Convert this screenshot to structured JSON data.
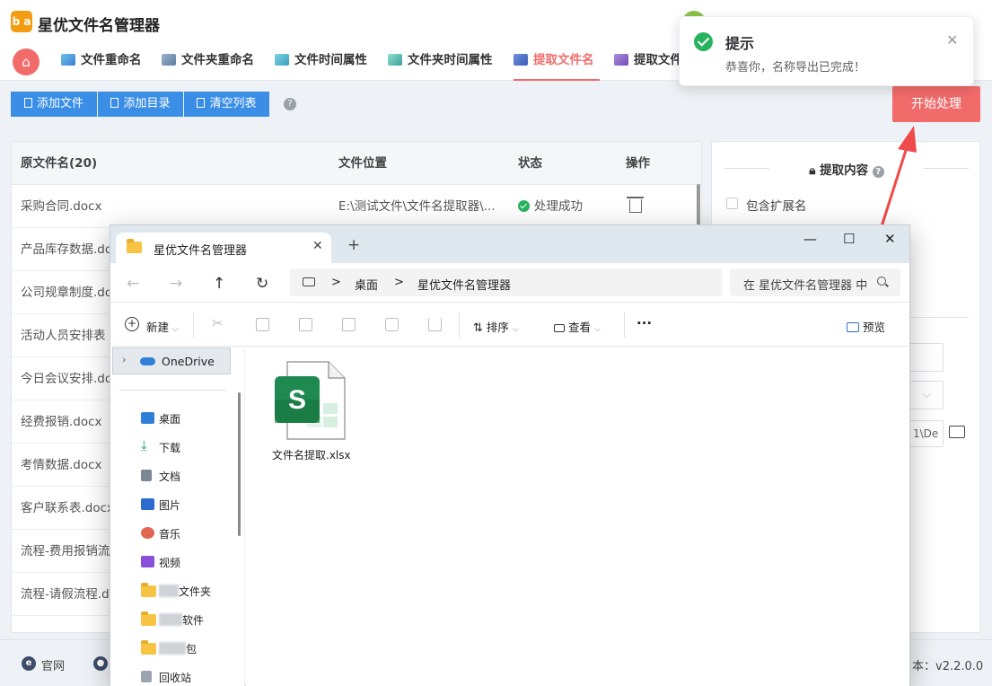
{
  "app": {
    "logo_text": "b a",
    "title": "星优文件名管理器",
    "window_controls": [
      "—",
      "☐",
      "✕"
    ]
  },
  "nav_tabs": [
    {
      "label": "文件重命名",
      "active": false
    },
    {
      "label": "文件夹重命名",
      "active": false
    },
    {
      "label": "文件时间属性",
      "active": false
    },
    {
      "label": "文件夹时间属性",
      "active": false
    },
    {
      "label": "提取文件名",
      "active": true
    },
    {
      "label": "提取文件",
      "active": false
    }
  ],
  "toolbar": {
    "add_file": "添加文件",
    "add_dir": "添加目录",
    "clear_list": "清空列表",
    "help": "?",
    "start": "开始处理"
  },
  "table": {
    "columns": [
      "原文件名(20)",
      "文件位置",
      "状态",
      "操作"
    ],
    "rows": [
      {
        "name": "采购合同.docx",
        "location": "E:\\测试文件\\文件名提取器\\...",
        "status": "处理成功"
      },
      {
        "name": "产品库存数据.do",
        "location": "",
        "status": ""
      },
      {
        "name": "公司规章制度.do",
        "location": "",
        "status": ""
      },
      {
        "name": "活动人员安排表",
        "location": "",
        "status": ""
      },
      {
        "name": "今日会议安排.do",
        "location": "",
        "status": ""
      },
      {
        "name": "经费报销.docx",
        "location": "",
        "status": ""
      },
      {
        "name": "考情数据.docx",
        "location": "",
        "status": ""
      },
      {
        "name": "客户联系表.docx",
        "location": "",
        "status": ""
      },
      {
        "name": "流程-费用报销流",
        "location": "",
        "status": ""
      },
      {
        "name": "流程-请假流程.d",
        "location": "",
        "status": ""
      }
    ]
  },
  "side": {
    "title": "提取内容",
    "help": "?",
    "option1": "包含扩展名",
    "path_fragment": "1\\De"
  },
  "statusbar": {
    "website": "官网",
    "version": "本：v2.2.0.0"
  },
  "toast": {
    "title": "提示",
    "message": "恭喜你，名称导出已完成！",
    "close": "✕"
  },
  "explorer": {
    "tab_title": "星优文件名管理器",
    "tab_close": "✕",
    "new_tab": "+",
    "window_controls": [
      "—",
      "☐",
      "✕"
    ],
    "nav_buttons": [
      "←",
      "→",
      "↑",
      "↻"
    ],
    "breadcrumb": [
      "桌面",
      "星优文件名管理器"
    ],
    "breadcrumb_sep": ">",
    "search_placeholder": "在 星优文件名管理器 中搜索",
    "commands": {
      "new": "新建",
      "sort": "排序",
      "view": "查看",
      "more": "···",
      "preview": "预览"
    },
    "onedrive": "OneDrive",
    "quick_access": [
      {
        "label": "桌面",
        "icon": "desktop-icon",
        "color": "#2f7fd8"
      },
      {
        "label": "下载",
        "icon": "download-icon",
        "color": "#1f9d6b"
      },
      {
        "label": "文档",
        "icon": "document-icon",
        "color": "#7b8794"
      },
      {
        "label": "图片",
        "icon": "pictures-icon",
        "color": "#2d6bd1"
      },
      {
        "label": "音乐",
        "icon": "music-icon",
        "color": "#e0664f"
      },
      {
        "label": "视频",
        "icon": "video-icon",
        "color": "#8a4fd8"
      },
      {
        "label": "文件夹",
        "icon": "folder-icon",
        "color": "#f6c343"
      },
      {
        "label": "软件",
        "icon": "folder-icon",
        "color": "#f6c343"
      },
      {
        "label": "包",
        "icon": "folder-icon",
        "color": "#f6c343"
      },
      {
        "label": "回收站",
        "icon": "recycle-bin-icon",
        "color": "#9aa5b1"
      }
    ],
    "file": {
      "name": "文件名提取.xlsx",
      "icon_letter": "S"
    }
  },
  "colors": {
    "accent": "#f26b6b",
    "primary_button": "#3a8ee6",
    "success": "#27b35e",
    "sheets_green": "#1f8a50"
  }
}
